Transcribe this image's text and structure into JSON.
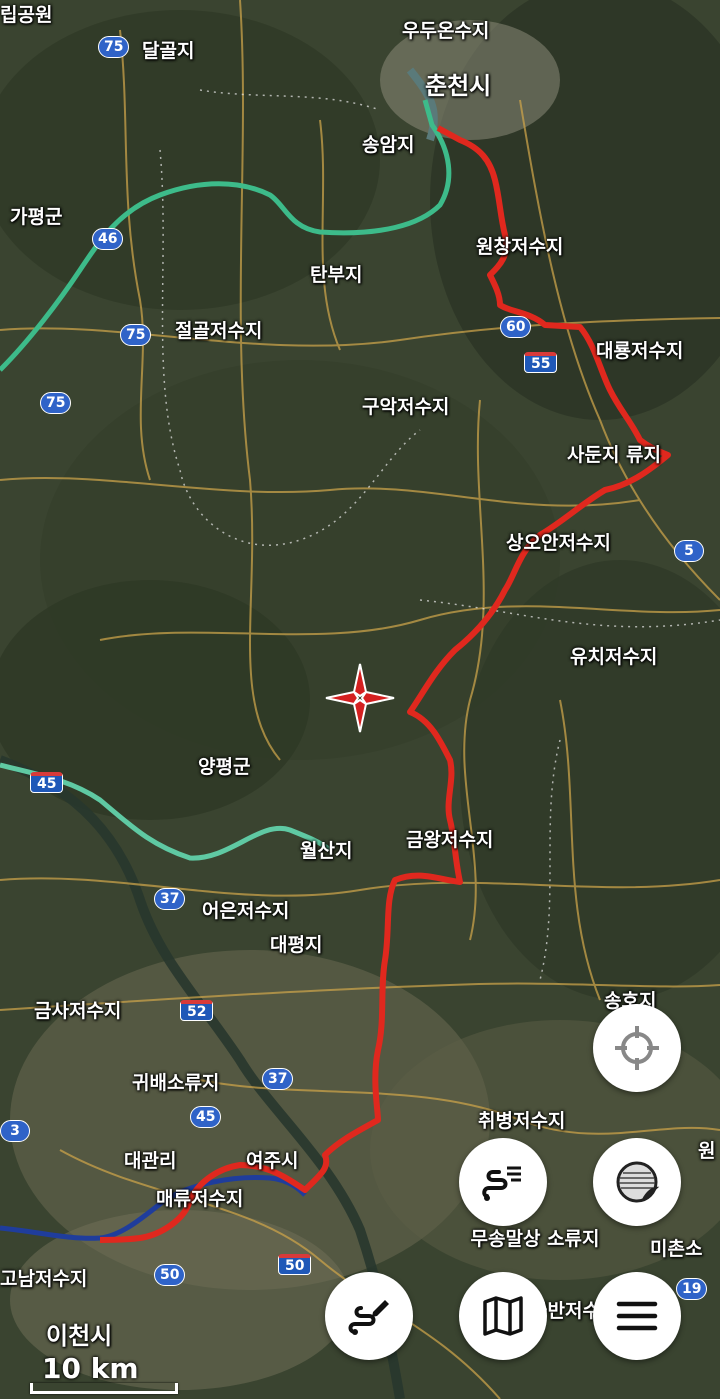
{
  "map": {
    "places": [
      {
        "id": "chuncheon",
        "label": "춘천시",
        "big": true
      },
      {
        "id": "udu",
        "label": "우두온수지"
      },
      {
        "id": "songam",
        "label": "송암지"
      },
      {
        "id": "wonchang",
        "label": "원창저수지"
      },
      {
        "id": "tanbu",
        "label": "탄부지"
      },
      {
        "id": "dalgol",
        "label": "달골지"
      },
      {
        "id": "gapyeong",
        "label": "가평군"
      },
      {
        "id": "jeolgol",
        "label": "절골저수지"
      },
      {
        "id": "daeryong",
        "label": "대룡저수지"
      },
      {
        "id": "guak",
        "label": "구악저수지"
      },
      {
        "id": "sadun",
        "label": "사둔지 류지"
      },
      {
        "id": "sangoan",
        "label": "상오안저수지"
      },
      {
        "id": "yuchi",
        "label": "유치저수지"
      },
      {
        "id": "yangpyeong",
        "label": "양평군"
      },
      {
        "id": "geumwang",
        "label": "금왕저수지"
      },
      {
        "id": "wolsan",
        "label": "월산지"
      },
      {
        "id": "eoeun",
        "label": "어은저수지"
      },
      {
        "id": "daepyeong",
        "label": "대평지"
      },
      {
        "id": "geumsa",
        "label": "금사저수지"
      },
      {
        "id": "gwibae",
        "label": "귀배소류지"
      },
      {
        "id": "chwibyeong",
        "label": "취병저수지"
      },
      {
        "id": "songho",
        "label": "송호지"
      },
      {
        "id": "daegwanri",
        "label": "대관리"
      },
      {
        "id": "maeryu",
        "label": "매류저수지"
      },
      {
        "id": "yeoju",
        "label": "여주시"
      },
      {
        "id": "gonam",
        "label": "고남저수지"
      },
      {
        "id": "icheon",
        "label": "이천시",
        "big": true
      },
      {
        "id": "museong",
        "label": "무송말상 소류지"
      },
      {
        "id": "geum",
        "label": "금반저수지"
      },
      {
        "id": "michon",
        "label": "미촌소"
      },
      {
        "id": "park",
        "label": "립공원"
      },
      {
        "id": "won",
        "label": "원"
      }
    ],
    "shields": [
      {
        "id": "r75a",
        "label": "75",
        "type": "national"
      },
      {
        "id": "r46",
        "label": "46",
        "type": "national"
      },
      {
        "id": "r75b",
        "label": "75",
        "type": "national"
      },
      {
        "id": "r75c",
        "label": "75",
        "type": "national"
      },
      {
        "id": "r60",
        "label": "60",
        "type": "expressway"
      },
      {
        "id": "r55",
        "label": "55",
        "type": "expressway"
      },
      {
        "id": "r5",
        "label": "5",
        "type": "national"
      },
      {
        "id": "r45a",
        "label": "45",
        "type": "national"
      },
      {
        "id": "r37a",
        "label": "37",
        "type": "national"
      },
      {
        "id": "r52",
        "label": "52",
        "type": "expressway"
      },
      {
        "id": "r37b",
        "label": "37",
        "type": "national"
      },
      {
        "id": "r45b",
        "label": "45",
        "type": "national"
      },
      {
        "id": "r3",
        "label": "3",
        "type": "national"
      },
      {
        "id": "r50a",
        "label": "50",
        "type": "national"
      },
      {
        "id": "r50b",
        "label": "50",
        "type": "expressway"
      },
      {
        "id": "r19",
        "label": "19",
        "type": "national"
      }
    ],
    "scale_label": "10 km",
    "colors": {
      "route": "#e0281e",
      "green_route": "#3dbb8a",
      "blue_route": "#1f3d9c",
      "terrain": "#3c4632"
    }
  },
  "controls": {
    "locate": {
      "icon": "crosshair-locate-icon"
    },
    "track_list": {
      "icon": "route-list-icon"
    },
    "map_layers": {
      "icon": "page-curl-layers-icon"
    },
    "draw_route": {
      "icon": "draw-route-icon"
    },
    "map_select": {
      "icon": "folded-map-icon"
    },
    "menu": {
      "icon": "hamburger-menu-icon"
    }
  }
}
